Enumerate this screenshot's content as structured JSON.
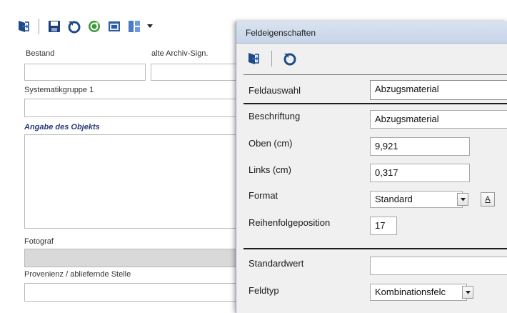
{
  "form": {
    "labels": {
      "bestand": "Bestand",
      "alte_archiv_sign": "alte Archiv-Sign.",
      "systematikgruppe": "Systematikgruppe 1",
      "angabe_objekts": "Angabe des Objekts",
      "fotograf": "Fotograf",
      "provenienz": "Provenienz / abliefernde Stelle"
    },
    "toolbar_icons": [
      "exit-icon",
      "save-icon",
      "undo-icon",
      "refresh-icon",
      "layout-icon",
      "columns-icon",
      "dropdown-arrow-icon"
    ]
  },
  "dialog": {
    "title": "Feldeigenschaften",
    "toolbar_icons": [
      "exit-icon",
      "undo-icon"
    ],
    "fields": {
      "feldauswahl": {
        "label": "Feldauswahl",
        "value": "Abzugsmaterial"
      },
      "beschriftung": {
        "label": "Beschriftung",
        "value": "Abzugsmaterial"
      },
      "oben": {
        "label": "Oben (cm)",
        "value": "9,921"
      },
      "links": {
        "label": "Links (cm)",
        "value": "0,317"
      },
      "format": {
        "label": "Format",
        "value": "Standard",
        "a_button": "A"
      },
      "reihenfolge": {
        "label": "Reihenfolgeposition",
        "value": "17"
      },
      "standardwert": {
        "label": "Standardwert",
        "value": ""
      },
      "feldtyp": {
        "label": "Feldtyp",
        "value": "Kombinationsfelc"
      }
    }
  },
  "colors": {
    "dialog_bg": "#f0f0f0",
    "title_bar": "#cfdaeb",
    "form_heading": "#2a3a7a"
  }
}
